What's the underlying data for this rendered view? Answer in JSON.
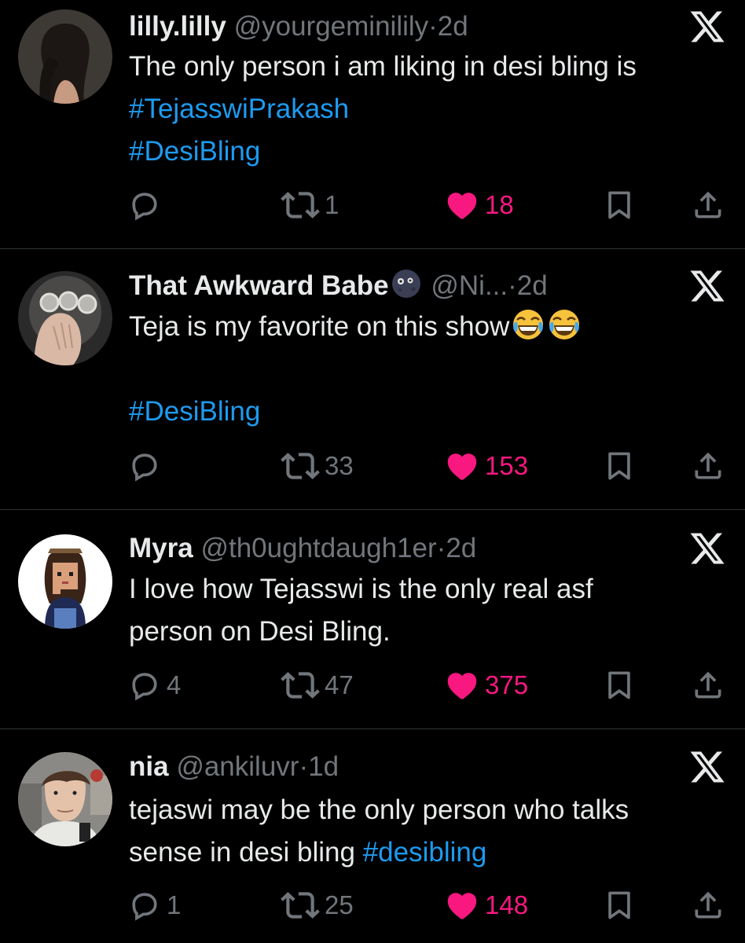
{
  "tweets": [
    {
      "name": "lilly.lilly",
      "handle": "@yourgeminilily",
      "separator": "·",
      "time": "2d",
      "lines": [
        [
          {
            "text": "The only person i am liking in desi bling  is",
            "tag": false
          }
        ],
        [
          {
            "text": "#TejasswiPrakash",
            "tag": true
          }
        ],
        [
          {
            "text": "#DesiBling",
            "tag": true
          }
        ]
      ],
      "replies": "",
      "reposts": "1",
      "likes": "18"
    },
    {
      "name": "That Awkward Babe",
      "name_emoji": "new-moon-face",
      "handle": "@Ni...",
      "separator": "·",
      "time": "2d",
      "lines": [
        [
          {
            "text": "Teja is my favorite on this show",
            "tag": false
          }
        ],
        [
          {
            "text": "",
            "tag": false
          }
        ],
        [
          {
            "text": "#DesiBling",
            "tag": true
          }
        ]
      ],
      "line_emojis": [
        "face-with-tears-of-joy",
        "face-with-tears-of-joy"
      ],
      "replies": "",
      "reposts": "33",
      "likes": "153"
    },
    {
      "name": "Myra",
      "handle": "@th0ughtdaugh1er",
      "separator": "·",
      "time": "2d",
      "lines": [
        [
          {
            "text": "I love how Tejasswi is the only real asf",
            "tag": false
          }
        ],
        [
          {
            "text": "person on Desi Bling.",
            "tag": false
          }
        ]
      ],
      "replies": "4",
      "reposts": "47",
      "likes": "375"
    },
    {
      "name": "nia",
      "handle": "@ankiluvr",
      "separator": "·",
      "time": "1d",
      "lines": [
        [
          {
            "text": "tejaswi may be the only person who talks",
            "tag": false
          }
        ],
        [
          {
            "text": "sense in desi bling ",
            "tag": false
          },
          {
            "text": "#desibling",
            "tag": true
          }
        ]
      ],
      "replies": "1",
      "reposts": "25",
      "likes": "148"
    }
  ],
  "colors": {
    "background": "#000000",
    "text": "#e7e9ea",
    "muted": "#71767b",
    "link": "#1d9bf0",
    "like": "#f91880",
    "divider": "#2f3336"
  },
  "icons": [
    "reply-icon",
    "repost-icon",
    "heart-icon",
    "bookmark-icon",
    "share-icon",
    "x-logo-icon"
  ]
}
